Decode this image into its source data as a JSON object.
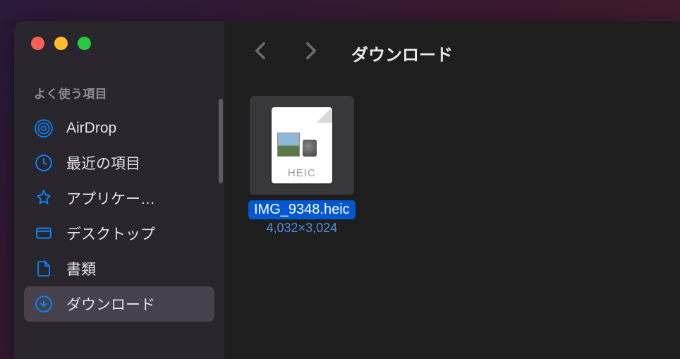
{
  "window": {
    "title": "ダウンロード"
  },
  "sidebar": {
    "section_header": "よく使う項目",
    "items": [
      {
        "label": "AirDrop",
        "icon": "airdrop",
        "selected": false
      },
      {
        "label": "最近の項目",
        "icon": "clock",
        "selected": false
      },
      {
        "label": "アプリケー…",
        "icon": "apps",
        "selected": false
      },
      {
        "label": "デスクトップ",
        "icon": "desktop",
        "selected": false
      },
      {
        "label": "書類",
        "icon": "document",
        "selected": false
      },
      {
        "label": "ダウンロード",
        "icon": "download",
        "selected": true
      }
    ]
  },
  "files": [
    {
      "name": "IMG_9348.heic",
      "format_label": "HEIC",
      "dimensions": "4,032×3,024",
      "selected": true
    }
  ]
}
